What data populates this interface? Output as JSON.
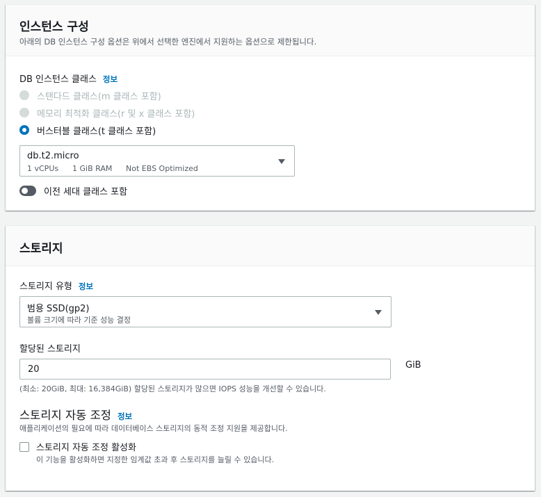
{
  "instance": {
    "title": "인스턴스 구성",
    "description": "아래의 DB 인스턴스 구성 옵션은 위에서 선택한 엔진에서 지원하는 옵션으로 제한됩니다.",
    "class_label": "DB 인스턴스 클래스",
    "info": "정보",
    "options": [
      {
        "label": "스탠다드 클래스(m 클래스 포함)",
        "state": "disabled"
      },
      {
        "label": "메모리 최적화 클래스(r 및 x 클래스 포함)",
        "state": "disabled"
      },
      {
        "label": "버스터블 클래스(t 클래스 포함)",
        "state": "selected"
      }
    ],
    "select": {
      "value": "db.t2.micro",
      "vcpus": "1 vCPUs",
      "ram": "1 GiB RAM",
      "ebs": "Not EBS Optimized"
    },
    "toggle_label": "이전 세대 클래스 포함"
  },
  "storage": {
    "title": "스토리지",
    "type_label": "스토리지 유형",
    "info": "정보",
    "type_select": {
      "value": "범용 SSD(gp2)",
      "description": "볼륨 크기에 따라 기준 성능 결정"
    },
    "allocated_label": "할당된 스토리지",
    "allocated_value": "20",
    "unit": "GiB",
    "allocated_hint": "(최소: 20GiB, 최대: 16,384GiB) 할당된 스토리지가 많으면 IOPS 성능을 개선할 수 있습니다.",
    "autoscaling": {
      "title": "스토리지 자동 조정",
      "info": "정보",
      "description": "애플리케이션의 필요에 따라 데이터베이스 스토리지의 동적 조정 지원을 제공합니다.",
      "checkbox_label": "스토리지 자동 조정 활성화",
      "checkbox_hint": "이 기능을 활성화하면 지정한 임계값 초과 후 스토리지를 늘릴 수 있습니다."
    }
  },
  "colors": {
    "accent": "#0073bb",
    "header_bg": "#fafafa",
    "page_bg": "#f2f3f3"
  }
}
